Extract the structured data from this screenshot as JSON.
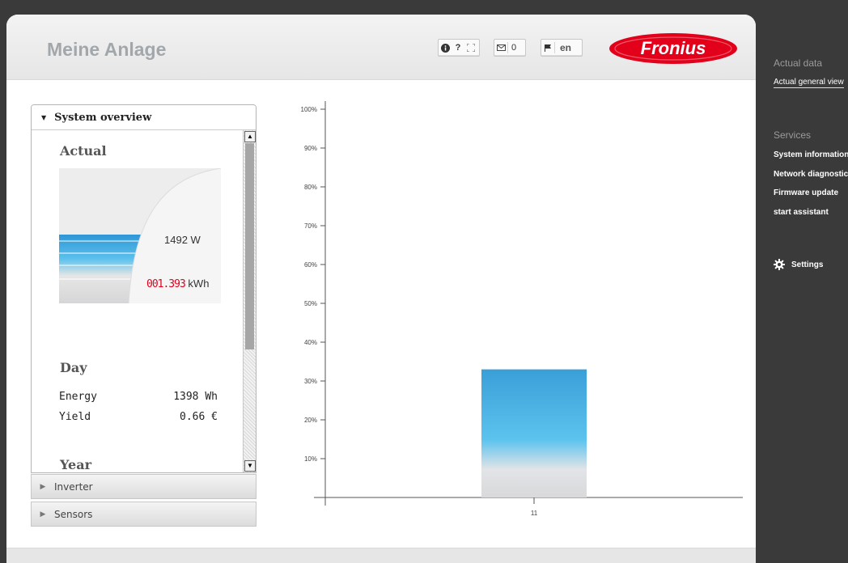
{
  "header": {
    "title": "Meine Anlage",
    "message_count": "0",
    "language": "en",
    "brand": "Fronius",
    "brand_color": "#e2001a"
  },
  "panel": {
    "title": "System overview",
    "actual": {
      "heading": "Actual",
      "power": "1492 W",
      "energy_counter": "001.393",
      "energy_unit": "kWh"
    },
    "day": {
      "heading": "Day",
      "energy_label": "Energy",
      "energy_value": "1398 Wh",
      "yield_label": "Yield",
      "yield_value": "0.66 €"
    },
    "year": {
      "heading": "Year"
    }
  },
  "accordion": [
    {
      "label": "Inverter"
    },
    {
      "label": "Sensors"
    }
  ],
  "chart_data": {
    "type": "bar",
    "categories": [
      "11"
    ],
    "values": [
      33
    ],
    "yticks": [
      "10%",
      "20%",
      "30%",
      "40%",
      "50%",
      "60%",
      "70%",
      "80%",
      "90%",
      "100%"
    ],
    "ylim": [
      0,
      100
    ],
    "xlabel": "",
    "ylabel": "",
    "bar_color_top": "#3a9fd8",
    "bar_color_bottom": "#d9d9db"
  },
  "sidebar": {
    "sections": [
      {
        "heading": "Actual data",
        "items": [
          "Actual general view"
        ]
      },
      {
        "heading": "Services",
        "items": [
          "System information",
          "Network diagnostics",
          "Firmware update",
          "start assistant"
        ]
      }
    ],
    "settings_label": "Settings"
  }
}
